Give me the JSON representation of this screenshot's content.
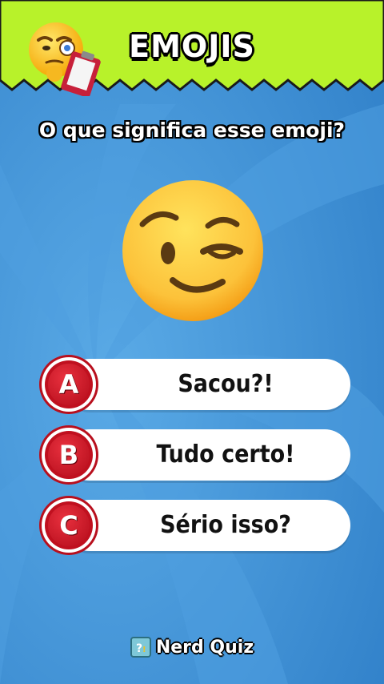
{
  "header": {
    "title": "EMOJIS",
    "mascot_icon": "thinking-emoji-clipboard-icon",
    "bar_color": "#b8f22a"
  },
  "question": {
    "text": "O que significa esse emoji?",
    "emoji_icon": "winking-face-icon"
  },
  "options": [
    {
      "letter": "A",
      "label": "Sacou?!"
    },
    {
      "letter": "B",
      "label": "Tudo certo!"
    },
    {
      "letter": "C",
      "label": "Sério isso?"
    }
  ],
  "footer": {
    "icon": "question-block-icon",
    "text": "Nerd Quiz"
  },
  "colors": {
    "background": "#3d8fd6",
    "option_circle": "#c0101f",
    "option_pill": "#ffffff"
  }
}
